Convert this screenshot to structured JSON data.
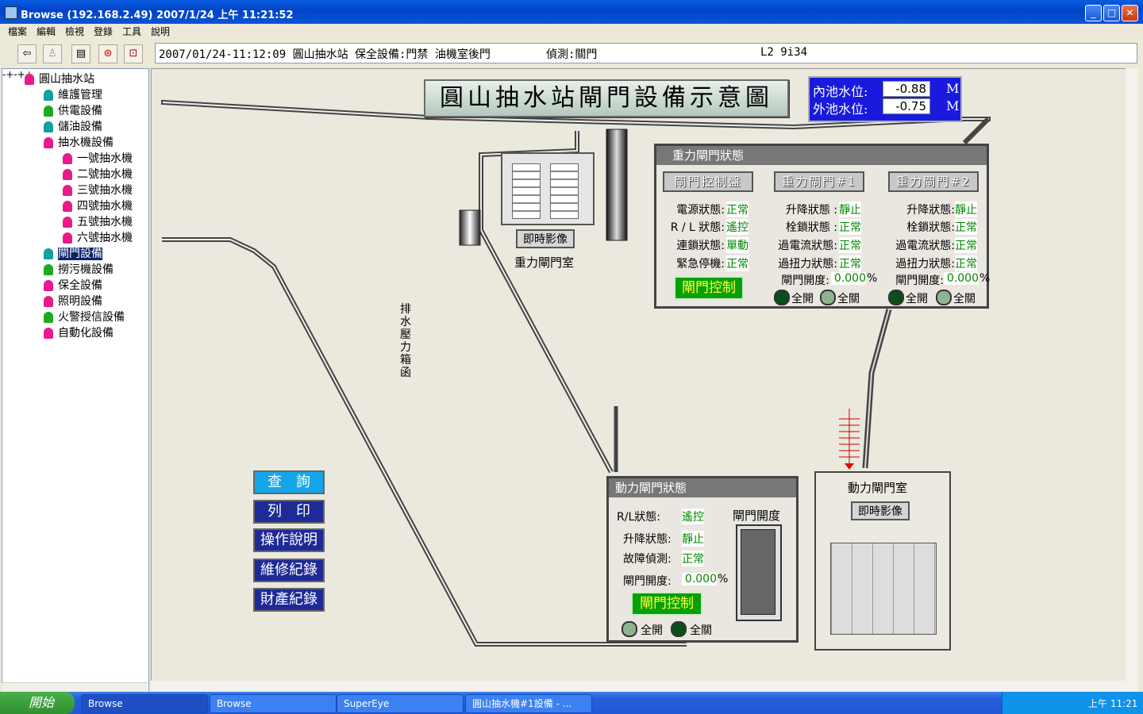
{
  "window": {
    "title": "Browse (192.168.2.49)    2007/1/24 上午 11:21:52"
  },
  "menu": [
    "檔案",
    "編輯",
    "檢視",
    "登錄",
    "工具",
    "說明"
  ],
  "info": {
    "event": "2007/01/24-11:12:09 圓山抽水站 保全設備:門禁 油機室後門",
    "detect": "偵測:關門",
    "code": "L2 9i34"
  },
  "tree": [
    {
      "label": "圓山抽水站",
      "color": "#e81a8c"
    },
    {
      "label": "維護管理",
      "color": "#12a0a0"
    },
    {
      "label": "供電設備",
      "color": "#1eaa1e"
    },
    {
      "label": "儲油設備",
      "color": "#12a0a0"
    },
    {
      "label": "抽水機設備",
      "color": "#e81a8c"
    },
    {
      "label": "一號抽水機",
      "color": "#e81a8c"
    },
    {
      "label": "二號抽水機",
      "color": "#e81a8c"
    },
    {
      "label": "三號抽水機",
      "color": "#e81a8c"
    },
    {
      "label": "四號抽水機",
      "color": "#e81a8c"
    },
    {
      "label": "五號抽水機",
      "color": "#e81a8c"
    },
    {
      "label": "六號抽水機",
      "color": "#e81a8c"
    },
    {
      "label": "閘門設備",
      "color": "#12a0a0"
    },
    {
      "label": "撈污機設備",
      "color": "#1eaa1e"
    },
    {
      "label": "保全設備",
      "color": "#e81a8c"
    },
    {
      "label": "照明設備",
      "color": "#e81a8c"
    },
    {
      "label": "火警授信設備",
      "color": "#1eaa1e"
    },
    {
      "label": "自動化設備",
      "color": "#e81a8c"
    }
  ],
  "diagram": {
    "title": "圓山抽水站閘門設備示意圖",
    "inner_label": "內池水位:",
    "inner_value": "-0.88",
    "outer_label": "外池水位:",
    "outer_value": "-0.75",
    "unit": "M",
    "drain_label": "排水壓力箱函",
    "gravity_room": "重力閘門室",
    "power_room": "動力閘門室",
    "live_video": "即時影像"
  },
  "gravity": {
    "title": "重力閘門狀態",
    "btn_panel": "閘門控制盤",
    "btn_gate1": "重力閘門#1",
    "btn_gate2": "重力閘門#2",
    "rows_panel": [
      {
        "k": "電源狀態:",
        "v": "正常"
      },
      {
        "k": "R / L 狀態:",
        "v": "遙控"
      },
      {
        "k": "連鎖狀態:",
        "v": "單動"
      },
      {
        "k": "緊急停機:",
        "v": "正常"
      }
    ],
    "rows_gate1": [
      {
        "k": "升降狀態 :",
        "v": "靜止"
      },
      {
        "k": "栓鎖狀態 :",
        "v": "正常"
      },
      {
        "k": "過電流狀態:",
        "v": "正常"
      },
      {
        "k": "過扭力狀態:",
        "v": "正常"
      }
    ],
    "rows_gate2": [
      {
        "k": "升降狀態:",
        "v": "靜止"
      },
      {
        "k": "栓鎖狀態:",
        "v": "正常"
      },
      {
        "k": "過電流狀態:",
        "v": "正常"
      },
      {
        "k": "過扭力狀態:",
        "v": "正常"
      }
    ],
    "opening_label": "閘門開度:",
    "opening1": "0.000",
    "opening2": "0.000",
    "pct": "%",
    "control": "閘門控制",
    "full_open": "全開",
    "full_close": "全關"
  },
  "power": {
    "title": "動力閘門狀態",
    "rows": [
      {
        "k": "R/L狀態:",
        "v": "遙控"
      },
      {
        "k": "升降狀態:",
        "v": "靜止"
      },
      {
        "k": "故障偵測:",
        "v": "正常"
      }
    ],
    "opening_label": "閘門開度:",
    "opening": "0.000",
    "pct": "%",
    "opening_header": "閘門開度",
    "control": "閘門控制",
    "full_open": "全開",
    "full_close": "全關"
  },
  "side_buttons": [
    "查　詢",
    "列　印",
    "操作說明",
    "維修紀錄",
    "財產紀錄"
  ],
  "taskbar": {
    "start": "開始",
    "tasks": [
      "Browse",
      "Browse",
      "SuperEye",
      "圓山抽水機#1設備 - ..."
    ],
    "clock": "上午 11:21"
  }
}
